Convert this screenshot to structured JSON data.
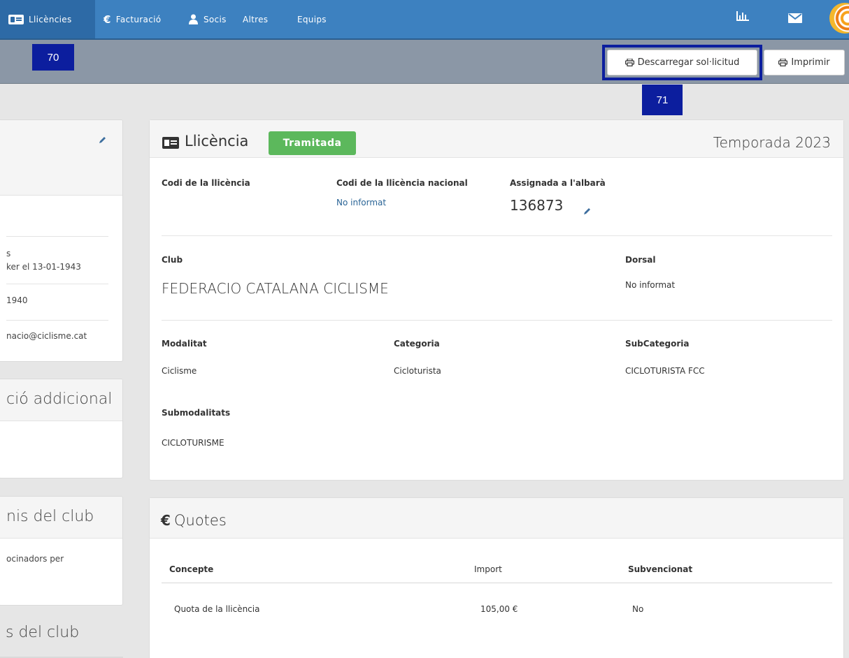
{
  "nav": {
    "items": [
      {
        "label": "Llicències",
        "icon": "id-card-icon"
      },
      {
        "label": "Facturació",
        "icon": "euro-icon"
      },
      {
        "label": "Socis",
        "icon": "user-icon"
      },
      {
        "label": "Altres"
      },
      {
        "label": "Equips"
      }
    ],
    "right_icons": [
      "bar-chart-icon",
      "envelope-icon",
      "logo"
    ]
  },
  "markers": {
    "m70": "70",
    "m71": "71"
  },
  "toolbar": {
    "download_label": "Descarregar sol·licitud",
    "print_label": "Imprimir"
  },
  "left": {
    "birth_line1": "s",
    "birth_line2": "ker el 13-01-1943",
    "year": "1940",
    "email": "nacio@ciclisme.cat",
    "additional_heading": "ció addicional",
    "club_heading": "nis del club",
    "club_text": "ocinadors per",
    "club2_heading": "s del club"
  },
  "license": {
    "title": "Llicència",
    "status": "Tramitada",
    "season": "Temporada 2023",
    "code_label": "Codi de la llicència",
    "national_label": "Codi de la llicència nacional",
    "national_value": "No informat",
    "albara_label": "Assignada a l'albarà",
    "albara_value": "136873",
    "club_label": "Club",
    "club_value": "FEDERACIO CATALANA CICLISME",
    "dorsal_label": "Dorsal",
    "dorsal_value": "No informat",
    "modalitat_label": "Modalitat",
    "modalitat_value": "Ciclisme",
    "categoria_label": "Categoria",
    "categoria_value": "Cicloturista",
    "subcategoria_label": "SubCategoria",
    "subcategoria_value": "CICLOTURISTA FCC",
    "submodalitats_label": "Submodalitats",
    "submodalitats_value": "CICLOTURISME"
  },
  "quotes": {
    "title": "Quotes",
    "columns": [
      "Concepte",
      "Import",
      "Subvencionat"
    ],
    "rows": [
      {
        "concepte": "Quota de la llicència",
        "import": "105,00 €",
        "subvencionat": "No"
      }
    ]
  },
  "colors": {
    "nav": "#3d81c0",
    "subbar": "#8b97a6",
    "marker": "#0c1e9e",
    "badge": "#5cb85c"
  }
}
